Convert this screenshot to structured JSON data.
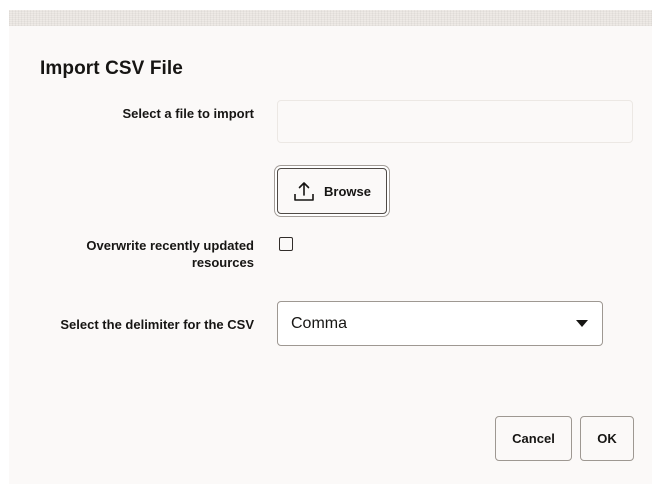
{
  "dialog": {
    "title": "Import CSV File"
  },
  "file_import": {
    "label": "Select a file to import",
    "value": "",
    "browse_label": "Browse",
    "browse_icon": "upload-icon"
  },
  "overwrite": {
    "label_line1": "Overwrite recently updated",
    "label_line2": "resources",
    "checked": false
  },
  "delimiter": {
    "label": "Select the delimiter for the CSV",
    "selected": "Comma",
    "caret_icon": "caret-down-icon"
  },
  "footer": {
    "cancel_label": "Cancel",
    "ok_label": "OK"
  }
}
